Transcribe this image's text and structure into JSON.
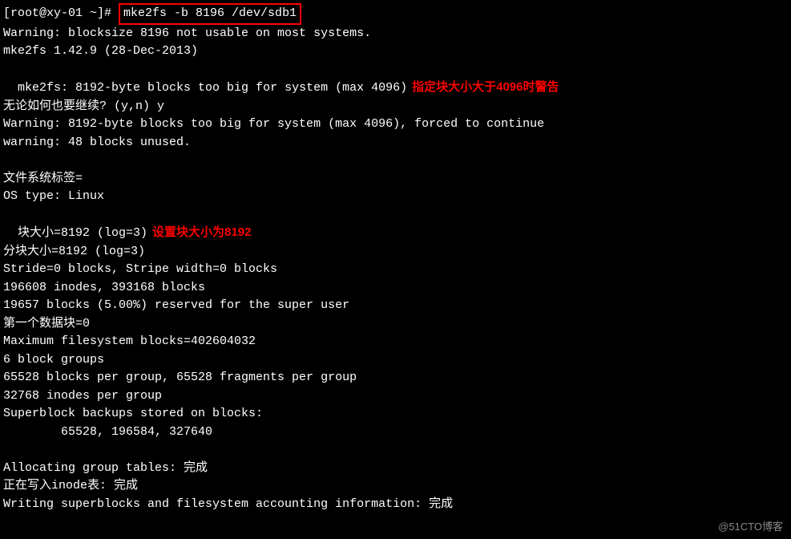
{
  "prompt": {
    "prefix": "[root@xy-01 ~]# ",
    "command": "mke2fs -b 8196 /dev/sdb1"
  },
  "output": {
    "line1": "Warning: blocksize 8196 not usable on most systems.",
    "line2": "mke2fs 1.42.9 (28-Dec-2013)",
    "line3": "mke2fs: 8192-byte blocks too big for system (max 4096)",
    "line4": "无论如何也要继续? (y,n) y",
    "line5": "Warning: 8192-byte blocks too big for system (max 4096), forced to continue",
    "line6": "warning: 48 blocks unused.",
    "blank1": " ",
    "line7": "文件系统标签=",
    "line8": "OS type: Linux",
    "line9": "块大小=8192 (log=3)",
    "line10": "分块大小=8192 (log=3)",
    "line11": "Stride=0 blocks, Stripe width=0 blocks",
    "line12": "196608 inodes, 393168 blocks",
    "line13": "19657 blocks (5.00%) reserved for the super user",
    "line14": "第一个数据块=0",
    "line15": "Maximum filesystem blocks=402604032",
    "line16": "6 block groups",
    "line17": "65528 blocks per group, 65528 fragments per group",
    "line18": "32768 inodes per group",
    "line19": "Superblock backups stored on blocks:",
    "line20": "        65528, 196584, 327640",
    "blank2": " ",
    "line21": "Allocating group tables: 完成",
    "line22": "正在写入inode表: 完成",
    "line23": "Writing superblocks and filesystem accounting information: 完成"
  },
  "annotations": {
    "note1": "指定块大小大于4096时警告",
    "note2": "设置块大小为8192"
  },
  "watermark": "@51CTO博客"
}
